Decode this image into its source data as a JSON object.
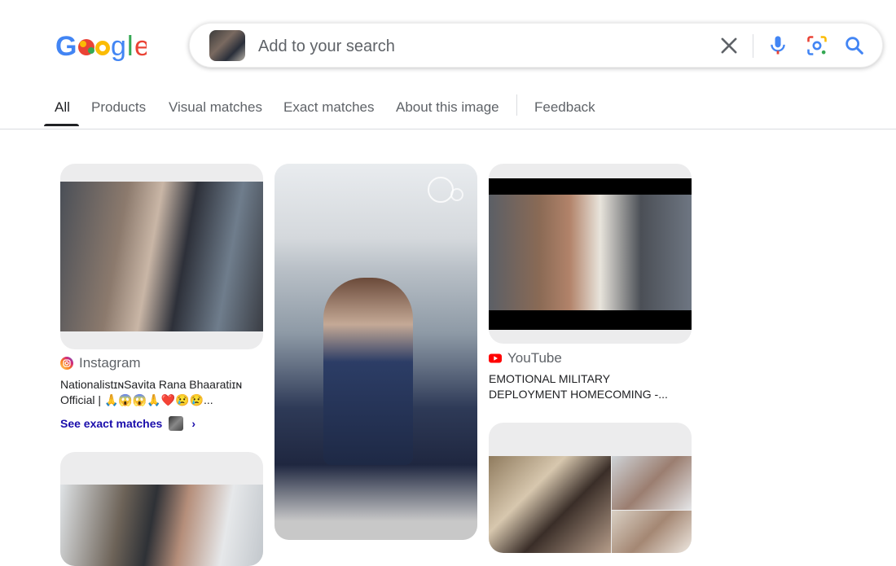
{
  "logo": {
    "text": "Google"
  },
  "search": {
    "placeholder": "Add to your search",
    "value": ""
  },
  "icons": {
    "clear": "close-icon",
    "voice": "microphone-icon",
    "lens": "lens-camera-icon",
    "search": "magnifier-icon"
  },
  "tabs": [
    {
      "label": "All",
      "active": true
    },
    {
      "label": "Products"
    },
    {
      "label": "Visual matches"
    },
    {
      "label": "Exact matches"
    },
    {
      "label": "About this image"
    },
    {
      "label": "Feedback"
    }
  ],
  "results": [
    {
      "source": "Instagram",
      "title": "NationalistɪɴSavita Rana Bhaaratiɪɴ Official | 🙏😱😱🙏❤️😢😢...",
      "see_exact": "See exact matches",
      "chevron": "›"
    },
    {
      "source": "YouTube",
      "title": "EMOTIONAL MILITARY DEPLOYMENT HOMECOMING -..."
    },
    {},
    {}
  ],
  "colors": {
    "google_blue": "#4285F4",
    "google_red": "#EA4335",
    "google_yellow": "#FBBC05",
    "google_green": "#34A853",
    "link": "#1a0dab",
    "youtube_red": "#FF0000"
  }
}
